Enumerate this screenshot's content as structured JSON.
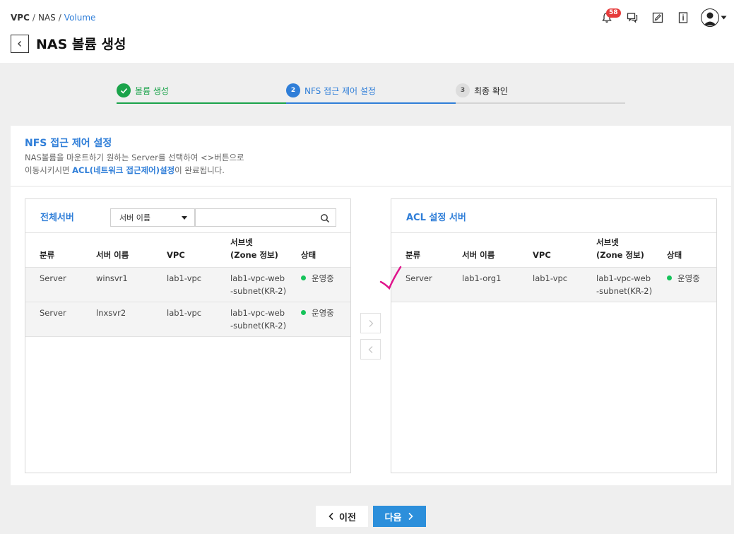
{
  "header": {
    "breadcrumb": [
      "VPC",
      "NAS",
      "Volume"
    ],
    "breadcrumb_sep": "/",
    "title": "NAS 볼륨 생성",
    "notification_count": "58"
  },
  "stepper": {
    "steps": [
      {
        "label": "볼륨 생성",
        "number": "",
        "state": "done"
      },
      {
        "label": "NFS 접근 제어 설정",
        "number": "2",
        "state": "active"
      },
      {
        "label": "최종 확인",
        "number": "3",
        "state": "pending"
      }
    ]
  },
  "section": {
    "title": "NFS 접근 제어 설정",
    "desc_line1": "NAS볼륨을 마운트하기 원하는 Server를 선택하여 <>버튼으로",
    "desc_line2_pre": "이동시키시면 ",
    "desc_line2_hl": "ACL(네트워크 접근제어)설정",
    "desc_line2_post": "이 완료됩니다."
  },
  "left_panel": {
    "title": "전체서버",
    "filter_select": "서버 이름",
    "search_value": "",
    "columns": [
      "분류",
      "서버 이름",
      "VPC",
      "서브넷\n(Zone 정보)",
      "상태"
    ],
    "rows": [
      {
        "type": "Server",
        "name": "winsvr1",
        "vpc": "lab1-vpc",
        "subnet": "lab1-vpc-web-subnet(KR-2)",
        "status": "운영중"
      },
      {
        "type": "Server",
        "name": "lnxsvr2",
        "vpc": "lab1-vpc",
        "subnet": "lab1-vpc-web-subnet(KR-2)",
        "status": "운영중"
      }
    ]
  },
  "right_panel": {
    "title": "ACL 설정 서버",
    "columns": [
      "분류",
      "서버 이름",
      "VPC",
      "서브넷\n(Zone 정보)",
      "상태"
    ],
    "rows": [
      {
        "type": "Server",
        "name": "lab1-org1",
        "vpc": "lab1-vpc",
        "subnet": "lab1-vpc-web-subnet(KR-2)",
        "status": "운영중"
      }
    ]
  },
  "footer": {
    "prev_label": "이전",
    "next_label": "다음"
  },
  "colors": {
    "accent": "#2f7ed8",
    "done": "#1aa34a",
    "status_running": "#16c35a",
    "next_button": "#2c8fdb",
    "annotation": "#e0148c"
  }
}
